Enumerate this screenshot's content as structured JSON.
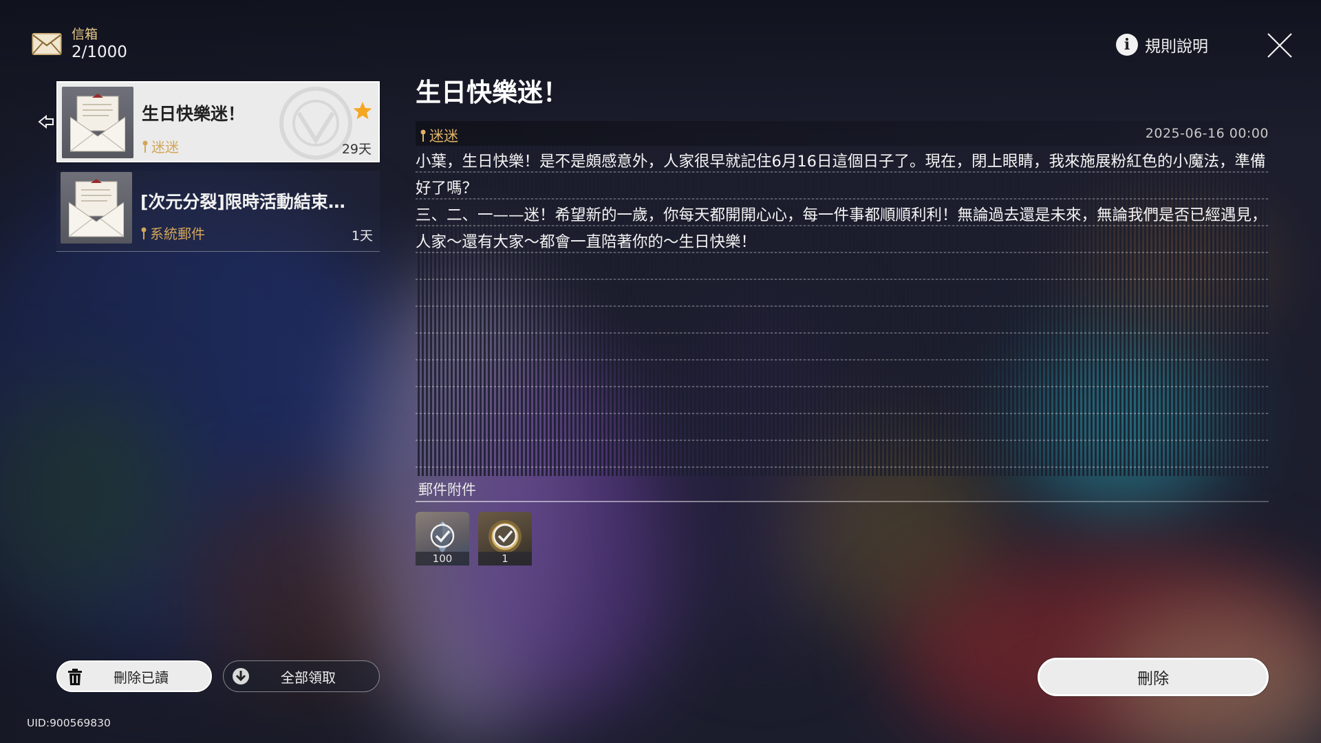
{
  "header": {
    "mailbox_label": "信箱",
    "mailbox_count": "2/1000",
    "rules_label": "規則說明"
  },
  "mail_list": [
    {
      "title": "生日快樂迷！",
      "sender": "迷迷",
      "days_left": "29天",
      "starred": true,
      "selected": true
    },
    {
      "title": "[次元分裂]限時活動結束…",
      "sender": "系統郵件",
      "days_left": "1天",
      "starred": false,
      "selected": false
    }
  ],
  "mail": {
    "title": "生日快樂迷！",
    "sender": "迷迷",
    "date": "2025-06-16 00:00",
    "paragraphs": [
      "小葉，生日快樂！是不是頗感意外，人家很早就記住6月16日這個日子了。現在，閉上眼睛，我來施展粉紅色的小魔法，準備好了嗎？",
      "三、二、一——迷！希望新的一歲，你每天都開開心心，每一件事都順順利利！無論過去還是未來，無論我們是否已經遇見，人家～還有大家～都會一直陪著你的～生日快樂！"
    ],
    "attachments_label": "郵件附件",
    "attachments": [
      {
        "icon": "crystal-icon",
        "quantity": "100",
        "claimed": true
      },
      {
        "icon": "medal-icon",
        "quantity": "1",
        "claimed": true
      }
    ]
  },
  "buttons": {
    "delete_read": "刪除已讀",
    "claim_all": "全部領取",
    "delete": "刪除"
  },
  "footer": {
    "uid": "UID:900569830"
  },
  "colors": {
    "accent_gold": "#d3a65a",
    "star": "#f5a623"
  }
}
